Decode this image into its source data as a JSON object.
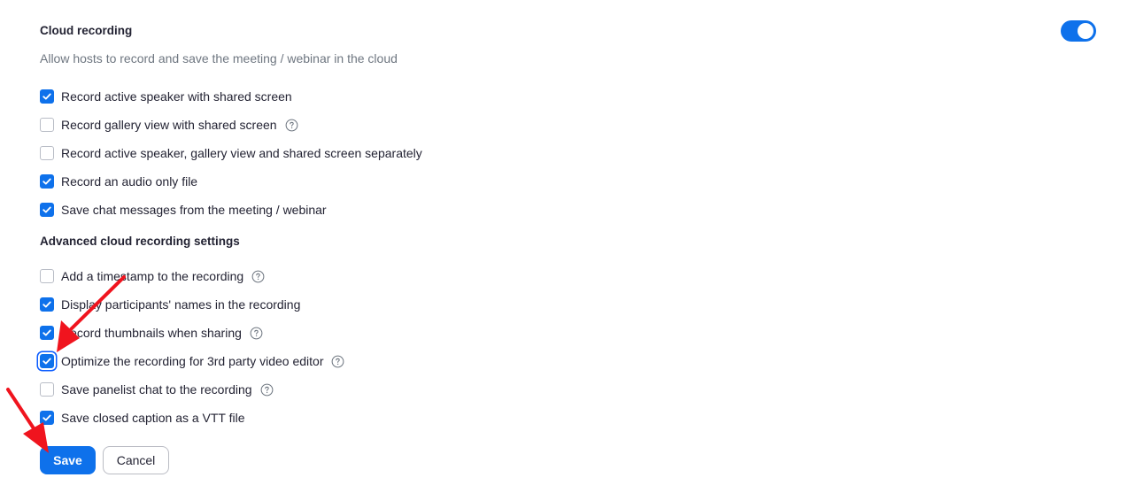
{
  "cloud_recording": {
    "title": "Cloud recording",
    "description": "Allow hosts to record and save the meeting / webinar in the cloud",
    "toggle_on": true,
    "options": [
      {
        "label": "Record active speaker with shared screen",
        "checked": true
      },
      {
        "label": "Record gallery view with shared screen",
        "checked": false,
        "help": true
      },
      {
        "label": "Record active speaker, gallery view and shared screen separately",
        "checked": false
      },
      {
        "label": "Record an audio only file",
        "checked": true
      },
      {
        "label": "Save chat messages from the meeting / webinar",
        "checked": true
      }
    ]
  },
  "advanced": {
    "title": "Advanced cloud recording settings",
    "options": [
      {
        "label": "Add a timestamp to the recording",
        "checked": false,
        "help": true
      },
      {
        "label": "Display participants' names in the recording",
        "checked": true
      },
      {
        "label": "Record thumbnails when sharing",
        "checked": true,
        "help": true
      },
      {
        "label": "Optimize the recording for 3rd party video editor",
        "checked": true,
        "help": true,
        "focused": true
      },
      {
        "label": "Save panelist chat to the recording",
        "checked": false,
        "help": true
      },
      {
        "label": "Save closed caption as a VTT file",
        "checked": true
      }
    ]
  },
  "buttons": {
    "save": "Save",
    "cancel": "Cancel"
  },
  "colors": {
    "accent": "#0e71eb",
    "annotation_arrow": "#f0141e"
  },
  "icons": {
    "checkbox_check": "check-icon",
    "help": "help-circle-icon",
    "annotation": "red-arrow-icon"
  }
}
